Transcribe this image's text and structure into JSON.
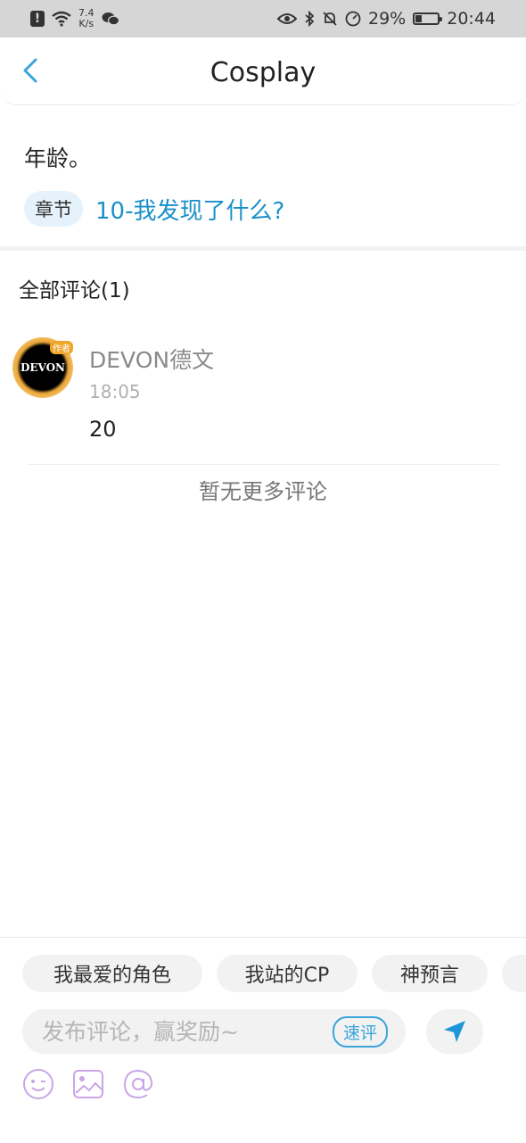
{
  "status_bar": {
    "alert_glyph": "!",
    "speed_value": "7.4",
    "speed_unit": "K/s",
    "battery_percent": "29%",
    "battery_level": 0.29,
    "time": "20:44"
  },
  "header": {
    "title": "Cosplay",
    "back_icon": "chevron-left-icon"
  },
  "post": {
    "text": "年龄。",
    "chapter_tag": "章节",
    "chapter_title": "10-我发现了什么?"
  },
  "comments_section": {
    "title": "全部评论(1)",
    "comments": [
      {
        "avatar_text": "DEVON",
        "avatar_badge": "作者",
        "username": "DEVON德文",
        "time": "18:05",
        "body": "20"
      }
    ],
    "no_more_text": "暂无更多评论"
  },
  "composer": {
    "chips": [
      "我最爱的角色",
      "我站的CP",
      "神预言",
      ""
    ],
    "input_placeholder": "发布评论，赢奖励~",
    "quick_review_label": "速评",
    "send_icon": "send-icon",
    "tool_icons": [
      "emoji-icon",
      "image-icon",
      "mention-icon"
    ]
  },
  "colors": {
    "accent": "#1a90c9",
    "accent_light": "#3aa4db",
    "chip_bg": "#f2f2f2",
    "status_bar_bg": "#d6d6d6",
    "tool_icon": "#c9a6e8"
  }
}
